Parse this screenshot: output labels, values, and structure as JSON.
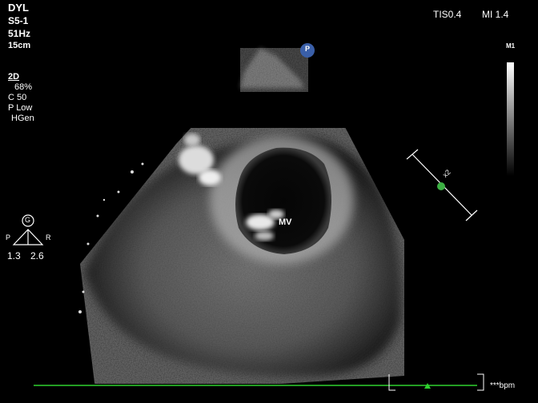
{
  "header": {
    "patient_id": "DYL",
    "probe": "S5-1",
    "frame_rate": "51Hz",
    "depth": "15cm",
    "tis": "TIS0.4",
    "mi": "MI 1.4"
  },
  "imaging_params": {
    "mode": "2D",
    "gain": "68%",
    "compression": "C 50",
    "power": "P Low",
    "harmonics": "HGen"
  },
  "orientation": {
    "badge_letter": "G",
    "left_label": "P",
    "right_label": "R",
    "left_value": "1.3",
    "right_value": "2.6"
  },
  "markers": {
    "probe_marker": "P",
    "grayscale_label": "M1",
    "structure_label": "MV",
    "scale_label": "x2"
  },
  "ecg": {
    "heart_rate": "***bpm"
  },
  "colors": {
    "ecg_trace": "#2fd12f",
    "scale_marker": "#3cb043",
    "probe_marker": "#3a5fa8"
  }
}
